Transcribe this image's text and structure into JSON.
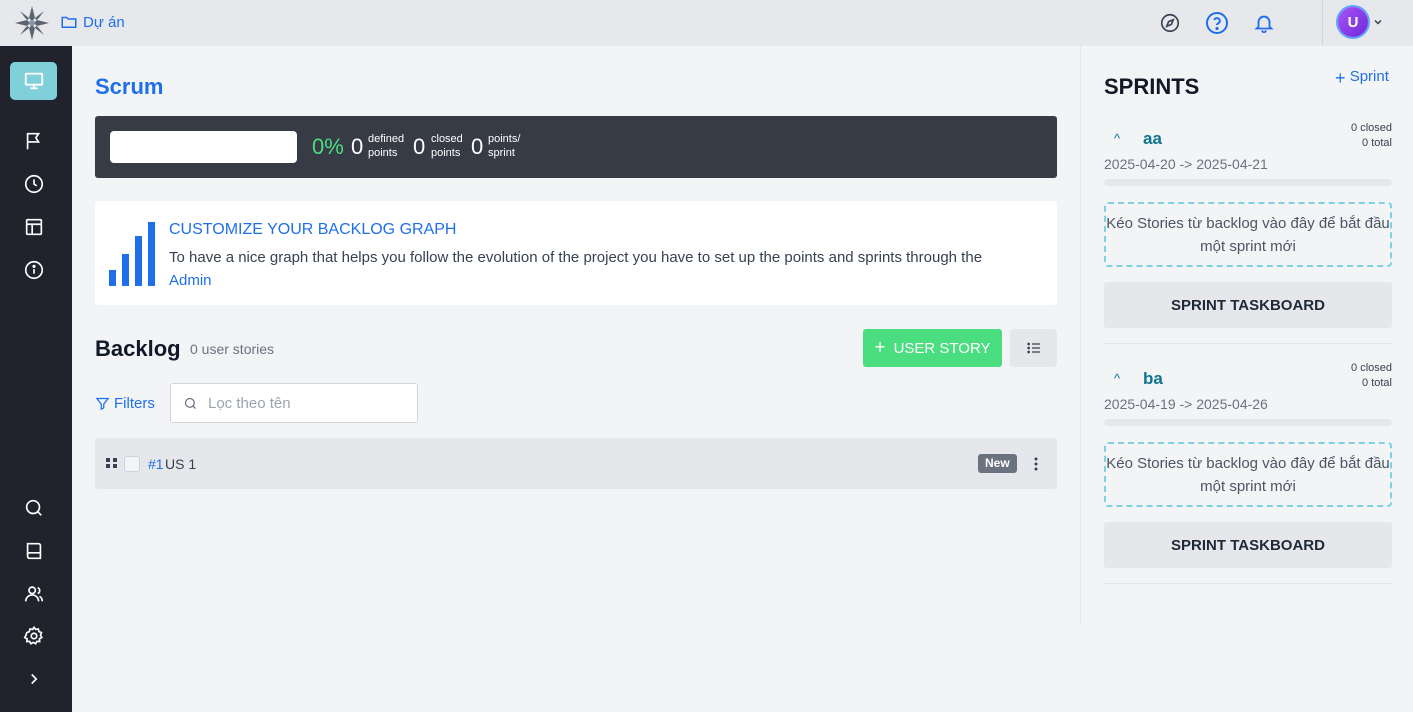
{
  "topbar": {
    "project_label": "Dự án",
    "avatar_initial": "U"
  },
  "main": {
    "title": "Scrum",
    "stats": {
      "percent": "0%",
      "defined_points": "0",
      "defined_label_1": "defined",
      "defined_label_2": "points",
      "closed_points": "0",
      "closed_label_1": "closed",
      "closed_label_2": "points",
      "points_per_sprint": "0",
      "pps_label_1": "points/",
      "pps_label_2": "sprint"
    },
    "graph_card": {
      "title": "CUSTOMIZE YOUR BACKLOG GRAPH",
      "text": "To have a nice graph that helps you follow the evolution of the project you have to set up the points and sprints through the",
      "link": "Admin"
    },
    "backlog": {
      "title": "Backlog",
      "count": "0 user stories",
      "add_story_label": "USER STORY",
      "filters_label": "Filters",
      "search_placeholder": "Lọc theo tên",
      "stories": [
        {
          "ref": "#1",
          "name": "US 1",
          "status": "New"
        }
      ]
    }
  },
  "sprints_panel": {
    "title": "SPRINTS",
    "add_label": "Sprint",
    "sprints": [
      {
        "name": "aa",
        "closed": "0 closed",
        "total": "0 total",
        "dates": "2025-04-20 -> 2025-04-21",
        "dropzone_text": "Kéo Stories từ backlog vào đây để bắt đầu một sprint mới",
        "taskboard_label": "SPRINT TASKBOARD"
      },
      {
        "name": "ba",
        "closed": "0 closed",
        "total": "0 total",
        "dates": "2025-04-19 -> 2025-04-26",
        "dropzone_text": "Kéo Stories từ backlog vào đây để bắt đầu một sprint mới",
        "taskboard_label": "SPRINT TASKBOARD"
      }
    ]
  },
  "colors": {
    "accent": "#1f6feb",
    "sidebar_bg": "#20232b",
    "active_nav": "#7fd0d9",
    "success": "#4ade80"
  },
  "icons": {
    "topbar": [
      "compass-icon",
      "help-icon",
      "bell-icon"
    ],
    "sidebar": [
      "monitor-icon",
      "flag-icon",
      "clock-icon",
      "table-icon",
      "info-icon",
      "search-icon",
      "book-icon",
      "users-icon",
      "gear-icon",
      "chevron-right-icon"
    ]
  }
}
